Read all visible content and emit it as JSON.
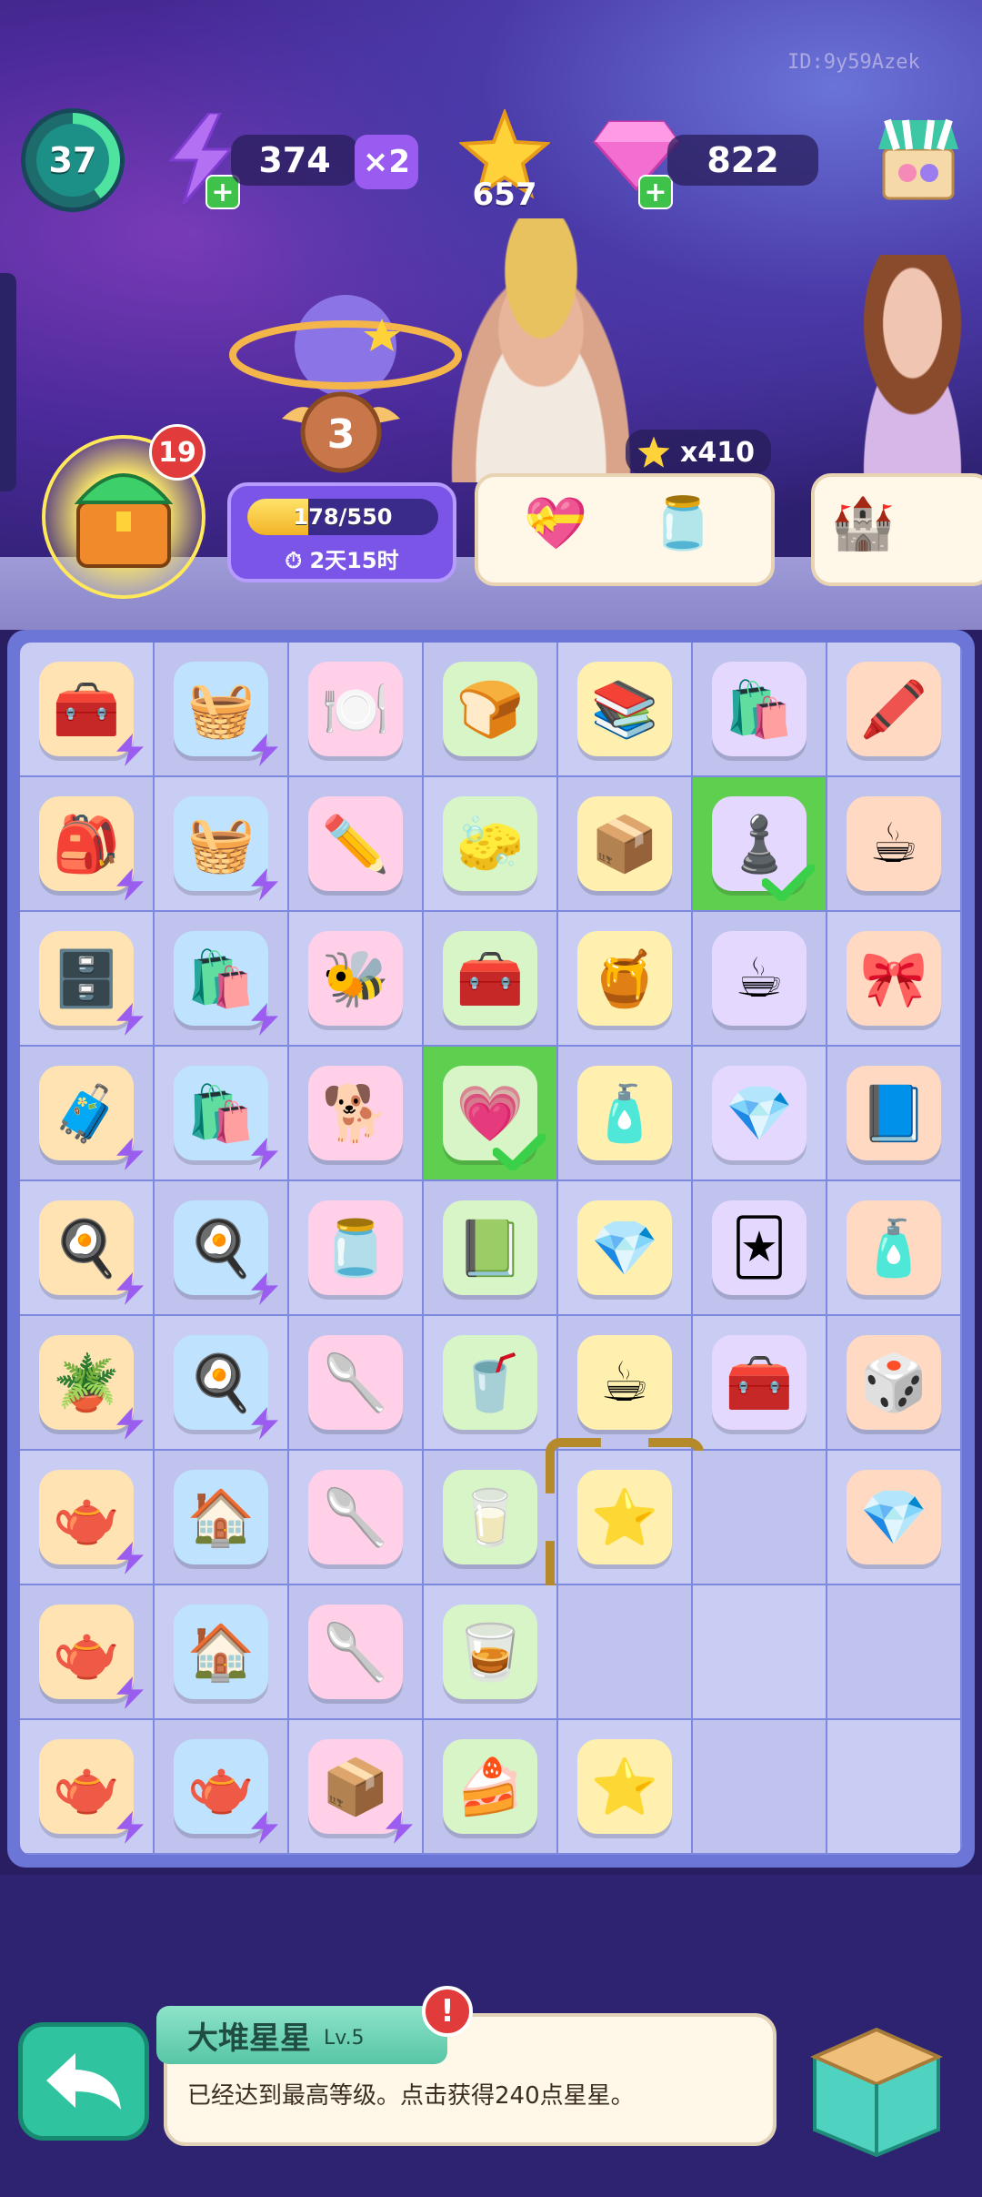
{
  "player_id": "ID:9y59Azek",
  "level": "37",
  "energy": {
    "value": "374",
    "multiplier": "×2"
  },
  "stars": "657",
  "gems": "822",
  "icons": {
    "energy": "lightning-icon",
    "star": "star-icon",
    "gem": "gem-icon",
    "shop": "shop-icon",
    "chest": "chest-icon",
    "back": "back-arrow-icon",
    "box": "cardboard-box-icon"
  },
  "character_bonus": "x410",
  "chest_badge": "19",
  "season": {
    "progress_text": "178/550",
    "progress": 0.32,
    "timer": "2天15时",
    "medal": "3"
  },
  "board": {
    "cells": [
      [
        "🧰",
        "🧺",
        "🍽️",
        "🍞",
        "📚",
        "🛍️",
        "🖍️"
      ],
      [
        "🎒",
        "🧺",
        "✏️",
        "🧽",
        "📦",
        "♟️",
        "☕"
      ],
      [
        "🗄️",
        "🛍️",
        "🐝",
        "🧰",
        "🍯",
        "☕",
        "🎀"
      ],
      [
        "🧳",
        "🛍️",
        "🐕",
        "💗",
        "🧴",
        "💎",
        "📘"
      ],
      [
        "🍳",
        "🍳",
        "🫙",
        "📗",
        "💎",
        "🃏",
        "🧴"
      ],
      [
        "🪴",
        "🍳",
        "🥄",
        "🥤",
        "☕",
        "🧰",
        "🎲"
      ],
      [
        "🫖",
        "🏠",
        "🥄",
        "🥛",
        "⭐",
        "",
        "💎"
      ],
      [
        "🫖",
        "🏠",
        "🥄",
        "🥃",
        "",
        "",
        ""
      ],
      [
        "🫖",
        "🫖",
        "📦",
        "🍰",
        "⭐",
        "",
        ""
      ]
    ],
    "bolts": [
      [
        0,
        0
      ],
      [
        0,
        1
      ],
      [
        1,
        0
      ],
      [
        1,
        1
      ],
      [
        2,
        0
      ],
      [
        2,
        1
      ],
      [
        3,
        0
      ],
      [
        3,
        1
      ],
      [
        4,
        0
      ],
      [
        4,
        1
      ],
      [
        5,
        0
      ],
      [
        5,
        1
      ],
      [
        6,
        0
      ],
      [
        7,
        0
      ],
      [
        8,
        0
      ],
      [
        8,
        1
      ],
      [
        8,
        2
      ]
    ],
    "done": [
      [
        1,
        5
      ],
      [
        3,
        3
      ]
    ],
    "selected": [
      6,
      4
    ]
  },
  "info": {
    "name": "大堆星星",
    "level": "Lv.5",
    "description": "已经达到最高等级。点击获得240点星星。",
    "alert": "!"
  },
  "colors": {
    "accent": "#7b55e8",
    "board": "#6c76d6",
    "done": "#5fcf4f",
    "alert": "#e23b3b"
  }
}
